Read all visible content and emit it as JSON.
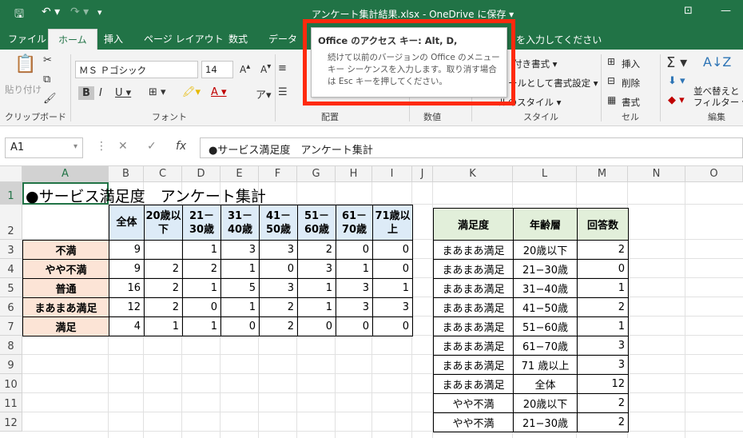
{
  "titlebar": {
    "title": "アンケート集計結果.xlsx - OneDrive に保存 ▾",
    "autosave_icon": "save-icon",
    "undo_icon": "undo-icon",
    "redo_icon": "redo-icon",
    "restore_icon": "ribbon-display-icon",
    "min_icon": "minimize-icon",
    "max_icon": "maximize-icon",
    "accent": "#217346"
  },
  "tabs": [
    {
      "label": "ファイル"
    },
    {
      "label": "ホーム"
    },
    {
      "label": "挿入"
    },
    {
      "label": "ページ レイアウト"
    },
    {
      "label": "数式"
    },
    {
      "label": "データ"
    }
  ],
  "tellme": "を入力してください",
  "ribbon": {
    "paste": "貼り付け",
    "clipboard": "クリップボード",
    "font_name": "ＭＳ Ｐゴシック",
    "font_size": "14",
    "font": "フォント",
    "haichi": "配置",
    "suuchi": "数値",
    "style": "スタイル",
    "cell": "セル",
    "edit": "編集",
    "cond_format": "付き書式 ▾",
    "table_format": "ールとして書式設定 ▾",
    "cell_style": "ルのスタイル ▾",
    "insert": "挿入",
    "delete": "削除",
    "format": "書式",
    "sort": "並べ替えと",
    "filter": "フィルター ▾"
  },
  "tooltip": {
    "heading": "Office のアクセス キー: Alt, D,",
    "body": "続けて以前のバージョンの Office のメニュー キー シーケンスを入力します。取り消す場合は Esc キーを押してください。"
  },
  "formula": {
    "namebox": "A1",
    "content": "●サービス満足度　アンケート集計"
  },
  "columns": [
    "A",
    "B",
    "C",
    "D",
    "E",
    "F",
    "G",
    "H",
    "I",
    "J",
    "K",
    "L",
    "M",
    "N",
    "O"
  ],
  "rows": [
    "1",
    "2",
    "3",
    "4",
    "5",
    "6",
    "7",
    "8",
    "9",
    "10",
    "11",
    "12"
  ],
  "sheet": {
    "title": "●サービス満足度　アンケート集計",
    "header": [
      "全体",
      "20歳以下",
      "21－30歳",
      "31－40歳",
      "41－50歳",
      "51－60歳",
      "61－70歳",
      "71歳以上"
    ],
    "labels": [
      "不満",
      "やや不満",
      "普通",
      "まあまあ満足",
      "満足"
    ],
    "data": [
      [
        "9",
        "",
        "1",
        "3",
        "3",
        "2",
        "0",
        "0"
      ],
      [
        "9",
        "2",
        "2",
        "1",
        "0",
        "3",
        "1",
        "0"
      ],
      [
        "16",
        "2",
        "1",
        "5",
        "3",
        "1",
        "3",
        "1"
      ],
      [
        "12",
        "2",
        "0",
        "1",
        "2",
        "1",
        "3",
        "3"
      ],
      [
        "4",
        "1",
        "1",
        "0",
        "2",
        "0",
        "0",
        "0"
      ]
    ],
    "list_header": [
      "満足度",
      "年齢層",
      "回答数"
    ],
    "list": [
      [
        "まあまあ満足",
        "20歳以下",
        "2"
      ],
      [
        "まあまあ満足",
        "21−30歳",
        "0"
      ],
      [
        "まあまあ満足",
        "31−40歳",
        "1"
      ],
      [
        "まあまあ満足",
        "41−50歳",
        "2"
      ],
      [
        "まあまあ満足",
        "51−60歳",
        "1"
      ],
      [
        "まあまあ満足",
        "61−70歳",
        "3"
      ],
      [
        "まあまあ満足",
        "71 歳以上",
        "3"
      ],
      [
        "まあまあ満足",
        "全体",
        "12"
      ],
      [
        "やや不満",
        "20歳以下",
        "2"
      ],
      [
        "やや不満",
        "21−30歳",
        "2"
      ]
    ]
  }
}
